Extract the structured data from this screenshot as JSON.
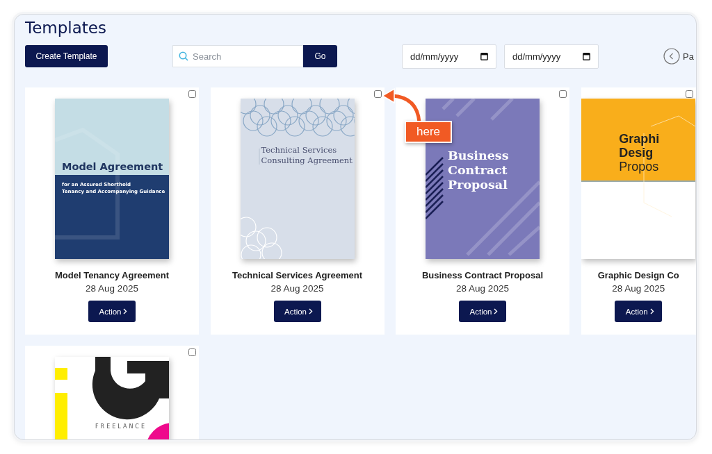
{
  "title": "Templates",
  "toolbar": {
    "create_button": "Create Template",
    "search": {
      "placeholder": "Search"
    },
    "go_button": "Go",
    "date_from": {
      "placeholder": "dd/mm/yyyy"
    },
    "date_to": {
      "placeholder": "dd/mm/yyyy"
    },
    "pager_label": "Pa"
  },
  "templates": [
    {
      "name": "Model Tenancy Agreement",
      "date": "28 Aug 2025",
      "action": "Action",
      "checked": false,
      "cover": {
        "kind": "tenancy",
        "lines": [
          "Model Agreement",
          "for an Assured Shorthold",
          "Tenancy and Accompanying Guidance"
        ]
      }
    },
    {
      "name": "Technical Services Agreement",
      "date": "28 Aug 2025",
      "action": "Action",
      "checked": false,
      "cover": {
        "kind": "technical",
        "lines": [
          "Technical Services",
          "Consulting Agreement"
        ]
      }
    },
    {
      "name": "Business Contract Proposal",
      "date": "28 Aug 2025",
      "action": "Action",
      "checked": false,
      "cover": {
        "kind": "business",
        "lines": [
          "Business",
          "Contract",
          "Proposal"
        ]
      }
    },
    {
      "name": "Graphic Design Co",
      "date": "28 Aug 2025",
      "action": "Action",
      "checked": false,
      "cover": {
        "kind": "graphic",
        "lines": [
          "Graphi",
          "Desig",
          "Propos"
        ]
      }
    },
    {
      "checked": false,
      "cover": {
        "kind": "freelance",
        "lines": [
          "FREELANCE"
        ]
      }
    }
  ],
  "callout": {
    "label": "here"
  }
}
